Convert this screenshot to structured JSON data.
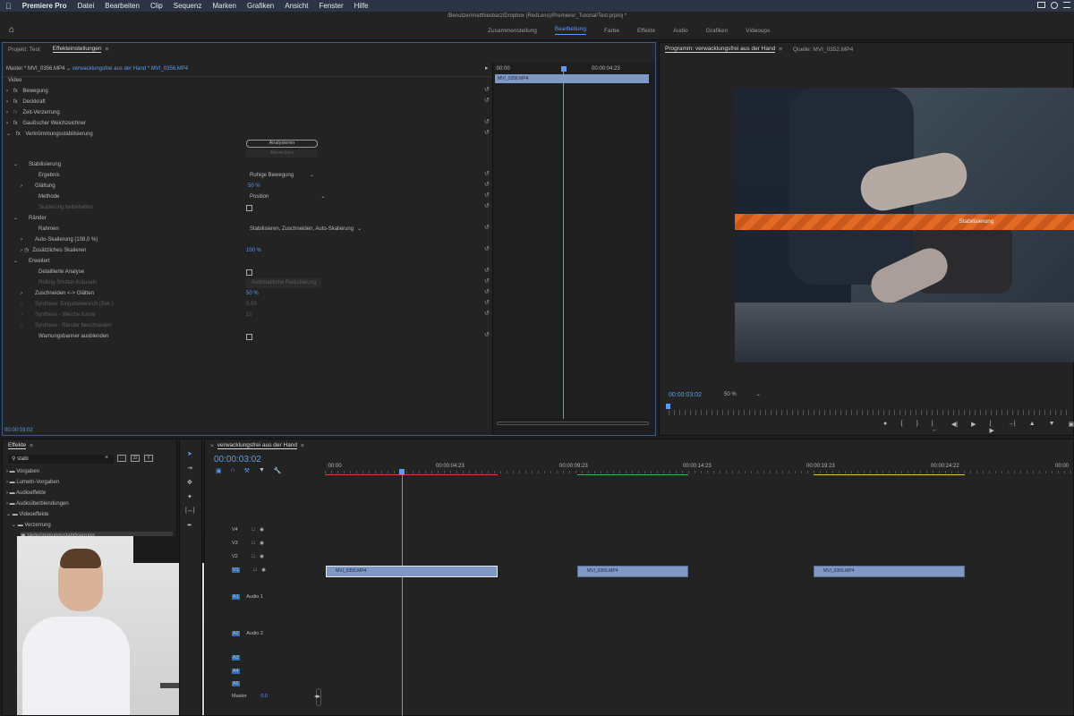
{
  "menubar": {
    "apple": "",
    "app": "Premiere Pro",
    "items": [
      "Datei",
      "Bearbeiten",
      "Clip",
      "Sequenz",
      "Marken",
      "Grafiken",
      "Ansicht",
      "Fenster",
      "Hilfe"
    ]
  },
  "window_title": "/Benutzer/matthiesbarz/Dropbox (RedLens)/Premiere/_Tutorial/Test.prproj *",
  "workspaces": [
    "Zusammenstellung",
    "Bearbeitung",
    "Farbe",
    "Effekte",
    "Audio",
    "Grafiken",
    "Videoups"
  ],
  "effect_panel": {
    "tabs": [
      "Projekt: Test",
      "Effekteinstellungen"
    ],
    "master": "Master * MVI_0356.MP4",
    "sequence_clip": "verwacklungsfrei aus der Hand * MVI_0356.MP4",
    "section": "Video",
    "effects": [
      "Bewegung",
      "Deckkraft",
      "Zeit-Verzerrung",
      "Gaußscher Weichzeichner",
      "Verkrümmungsstabilisierung"
    ],
    "analyze_button": "Analysieren",
    "cancel_button": "Abbrechen",
    "stabilization": "Stabilisierung",
    "result_label": "Ergebnis",
    "result_value": "Ruhige Bewegung",
    "smoothness_label": "Glättung",
    "smoothness_value": "50 %",
    "method_label": "Methode",
    "method_value": "Position",
    "preserve_scaling": "Skalierung beibehalten",
    "borders": "Ränder",
    "framing_label": "Rahmen",
    "framing_value": "Stabilisieren, Zuschneiden, Auto-Skalierung",
    "auto_scale": "Auto-Skalierung (108,0 %)",
    "additional_scale_label": "Zusätzliches Skalieren",
    "additional_scale_value": "100 %",
    "advanced": "Erweitert",
    "detailed_analysis": "Detaillierte Analyse",
    "rolling_shutter": "Rolling-Shutter-Kräuseln",
    "rolling_shutter_value": "Automatische Reduzierung",
    "crop_smooth_label": "Zuschneiden <-> Glätten",
    "crop_smooth_value": "50 %",
    "synth_edge": "Synthese: Eingabebereich (Sek.)",
    "synth_edge_value": "0,50",
    "synth_feather": "Synthese - Weiche Kante",
    "synth_feather_value": "10",
    "synth_crop": "Synthese - Ränder beschneiden",
    "hide_warning": "Warnungsbanner ausblenden",
    "timecode": "00:00:03:02",
    "ruler_start": ":00:00",
    "ruler_end": "00:00:04:23",
    "clip_label": "MVI_0356.MP4"
  },
  "program_monitor": {
    "tabs": [
      "Programm: verwacklungsfrei aus der Hand",
      "Quelle: MVI_0352.MP4"
    ],
    "banner": "Stabilisierung",
    "timecode": "00:00:03:02",
    "zoom": "50 %"
  },
  "effects_panel": {
    "title": "Effekte",
    "search": "stabi",
    "tree": [
      "Vorgaben",
      "Lumetri-Vorgaben",
      "Audioeffekte",
      "Audioüberblendungen",
      "Videoeffekte",
      "Verzerrung",
      "Verkrümmungsstabilisierung"
    ]
  },
  "timeline": {
    "title": "verwacklungsfrei aus der Hand",
    "timecode": "00:00:03:02",
    "ruler": [
      ":00:00",
      "00:00:04:23",
      "00:00:09:23",
      "00:00:14:23",
      "00:00:19:23",
      "00:00:24:22",
      "00:00"
    ],
    "tracks_video": [
      "V4",
      "V3",
      "V2",
      "V1"
    ],
    "tracks_audio": [
      "A1",
      "A2",
      "A3",
      "A4",
      "A5"
    ],
    "audio_names": [
      "Audio 1",
      "Audio 2"
    ],
    "clips": [
      "MVI_0356.MP4",
      "MVI_0356.MP4",
      "MVI_0356.MP4"
    ],
    "master_label": "Master",
    "master_value": "0.0"
  },
  "colors": {
    "accent": "#5b9bf2",
    "banner": "#e36a24",
    "clip": "#7f98c6"
  }
}
